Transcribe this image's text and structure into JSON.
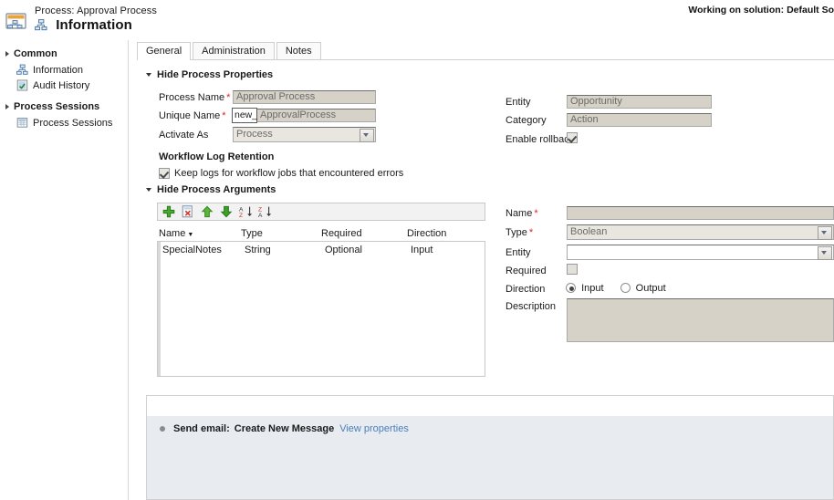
{
  "header": {
    "breadcrumb": "Process: Approval Process",
    "title": "Information",
    "solution_label": "Working on solution: Default So",
    "window_icon": "process-icon",
    "title_icon": "process-node-icon"
  },
  "sidebar": {
    "groups": [
      {
        "label": "Common",
        "items": [
          {
            "label": "Information",
            "icon": "process-node-icon"
          },
          {
            "label": "Audit History",
            "icon": "audit-history-icon"
          }
        ]
      },
      {
        "label": "Process Sessions",
        "items": [
          {
            "label": "Process Sessions",
            "icon": "grid-icon"
          }
        ]
      }
    ]
  },
  "tabs": [
    {
      "label": "General",
      "selected": true
    },
    {
      "label": "Administration",
      "selected": false
    },
    {
      "label": "Notes",
      "selected": false
    }
  ],
  "process_properties": {
    "section_label": "Hide Process Properties",
    "process_name_label": "Process Name",
    "process_name_value": "Approval Process",
    "unique_name_label": "Unique Name",
    "unique_name_prefix": "new_",
    "unique_name_value": "ApprovalProcess",
    "activate_as_label": "Activate As",
    "activate_as_value": "Process",
    "entity_label": "Entity",
    "entity_value": "Opportunity",
    "category_label": "Category",
    "category_value": "Action",
    "enable_rollback_label": "Enable rollback",
    "enable_rollback_checked": true
  },
  "log_retention": {
    "heading": "Workflow Log Retention",
    "checkbox_label": "Keep logs for workflow jobs that encountered errors",
    "checked": true
  },
  "process_arguments": {
    "section_label": "Hide Process Arguments",
    "toolbar": [
      {
        "name": "add-argument-button",
        "icon": "plus-icon"
      },
      {
        "name": "delete-argument-button",
        "icon": "delete-icon"
      },
      {
        "name": "move-up-button",
        "icon": "arrow-up-icon"
      },
      {
        "name": "move-down-button",
        "icon": "arrow-down-icon"
      },
      {
        "name": "sort-ascending-button",
        "icon": "sort-az-icon"
      },
      {
        "name": "sort-descending-button",
        "icon": "sort-za-icon"
      }
    ],
    "columns": [
      "Name",
      "Type",
      "Required",
      "Direction"
    ],
    "rows": [
      {
        "name": "SpecialNotes",
        "type": "String",
        "required": "Optional",
        "direction": "Input"
      }
    ]
  },
  "argument_detail": {
    "name_label": "Name",
    "name_value": "",
    "type_label": "Type",
    "type_value": "Boolean",
    "entity_label": "Entity",
    "entity_value": "",
    "required_label": "Required",
    "required_checked": false,
    "direction_label": "Direction",
    "direction_input_label": "Input",
    "direction_output_label": "Output",
    "direction_selected": "Input",
    "description_label": "Description",
    "description_value": ""
  },
  "steps": [
    {
      "prefix": "Send email:",
      "text": "Create New Message",
      "link": "View properties"
    }
  ]
}
